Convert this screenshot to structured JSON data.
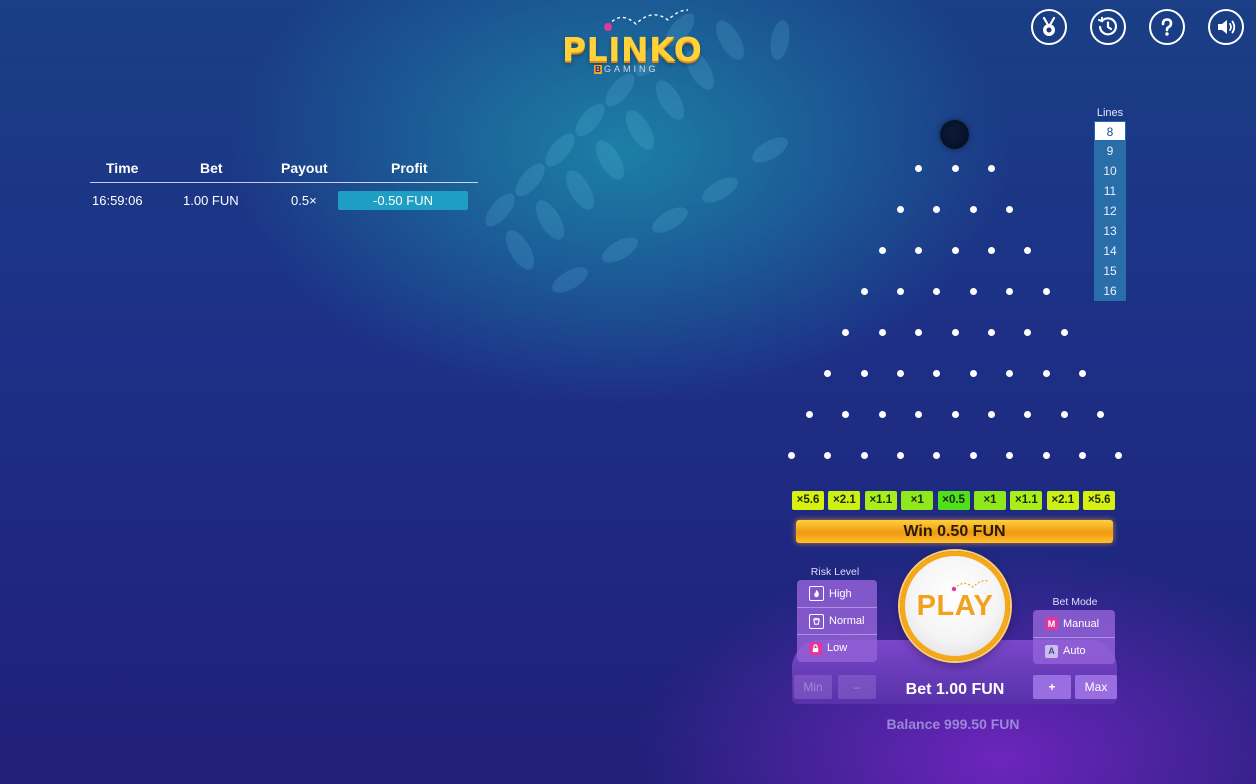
{
  "logo": {
    "title": "PLINKO",
    "sub_b": "B",
    "sub_rest": "GAMING"
  },
  "top_icons": [
    "medal-icon",
    "history-icon",
    "help-icon",
    "sound-icon"
  ],
  "history": {
    "headers": {
      "time": "Time",
      "bet": "Bet",
      "payout": "Payout",
      "profit": "Profit"
    },
    "rows": [
      {
        "time": "16:59:06",
        "bet": "1.00 FUN",
        "payout": "0.5×",
        "profit": "-0.50 FUN"
      }
    ]
  },
  "lines": {
    "label": "Lines",
    "options": [
      "8",
      "9",
      "10",
      "11",
      "12",
      "13",
      "14",
      "15",
      "16"
    ],
    "selected": "8"
  },
  "multipliers": [
    {
      "label": "×5.6",
      "color": "#d6f00f"
    },
    {
      "label": "×2.1",
      "color": "#cdf014"
    },
    {
      "label": "×1.1",
      "color": "#a9ee1a"
    },
    {
      "label": "×1",
      "color": "#8ee81b"
    },
    {
      "label": "×0.5",
      "color": "#4fe01a"
    },
    {
      "label": "×1",
      "color": "#8ee81b"
    },
    {
      "label": "×1.1",
      "color": "#a9ee1a"
    },
    {
      "label": "×2.1",
      "color": "#cdf014"
    },
    {
      "label": "×5.6",
      "color": "#d6f00f"
    }
  ],
  "win_banner": "Win 0.50 FUN",
  "risk": {
    "label": "Risk Level",
    "options": [
      "High",
      "Normal",
      "Low"
    ],
    "selected": "Low"
  },
  "play_label": "PLAY",
  "bet_mode": {
    "label": "Bet Mode",
    "options": [
      {
        "badge": "M",
        "label": "Manual"
      },
      {
        "badge": "A",
        "label": "Auto"
      }
    ],
    "selected": "Manual"
  },
  "bet": {
    "min_label": "Min",
    "minus_label": "–",
    "plus_label": "+",
    "max_label": "Max",
    "text": "Bet 1.00 FUN"
  },
  "balance": "Balance 999.50 FUN",
  "colors": {
    "accent_orange": "#f5a91a",
    "panel_purple": "#7e48cd",
    "profit_bg": "#1f9ec3",
    "selected_badge": "#e0389a"
  }
}
